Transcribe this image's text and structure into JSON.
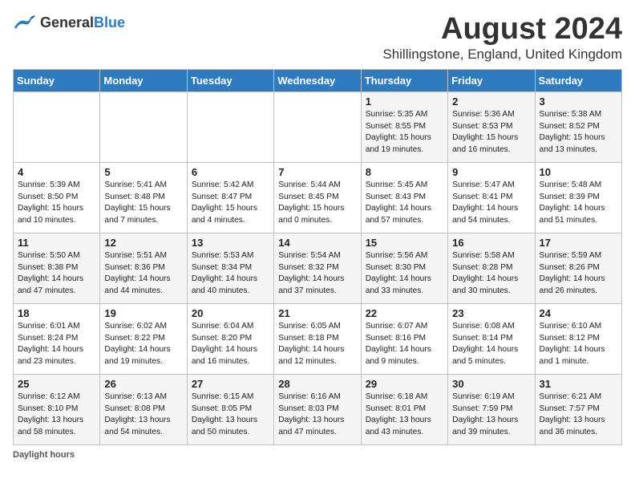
{
  "logo": {
    "general": "General",
    "blue": "Blue"
  },
  "title": "August 2024",
  "subtitle": "Shillingstone, England, United Kingdom",
  "days_of_week": [
    "Sunday",
    "Monday",
    "Tuesday",
    "Wednesday",
    "Thursday",
    "Friday",
    "Saturday"
  ],
  "footer": {
    "label": "Daylight hours",
    "note": "Daylight hours"
  },
  "weeks": [
    [
      {
        "day": "",
        "info": ""
      },
      {
        "day": "",
        "info": ""
      },
      {
        "day": "",
        "info": ""
      },
      {
        "day": "",
        "info": ""
      },
      {
        "day": "1",
        "info": "Sunrise: 5:35 AM\nSunset: 8:55 PM\nDaylight: 15 hours\nand 19 minutes."
      },
      {
        "day": "2",
        "info": "Sunrise: 5:36 AM\nSunset: 8:53 PM\nDaylight: 15 hours\nand 16 minutes."
      },
      {
        "day": "3",
        "info": "Sunrise: 5:38 AM\nSunset: 8:52 PM\nDaylight: 15 hours\nand 13 minutes."
      }
    ],
    [
      {
        "day": "4",
        "info": "Sunrise: 5:39 AM\nSunset: 8:50 PM\nDaylight: 15 hours\nand 10 minutes."
      },
      {
        "day": "5",
        "info": "Sunrise: 5:41 AM\nSunset: 8:48 PM\nDaylight: 15 hours\nand 7 minutes."
      },
      {
        "day": "6",
        "info": "Sunrise: 5:42 AM\nSunset: 8:47 PM\nDaylight: 15 hours\nand 4 minutes."
      },
      {
        "day": "7",
        "info": "Sunrise: 5:44 AM\nSunset: 8:45 PM\nDaylight: 15 hours\nand 0 minutes."
      },
      {
        "day": "8",
        "info": "Sunrise: 5:45 AM\nSunset: 8:43 PM\nDaylight: 14 hours\nand 57 minutes."
      },
      {
        "day": "9",
        "info": "Sunrise: 5:47 AM\nSunset: 8:41 PM\nDaylight: 14 hours\nand 54 minutes."
      },
      {
        "day": "10",
        "info": "Sunrise: 5:48 AM\nSunset: 8:39 PM\nDaylight: 14 hours\nand 51 minutes."
      }
    ],
    [
      {
        "day": "11",
        "info": "Sunrise: 5:50 AM\nSunset: 8:38 PM\nDaylight: 14 hours\nand 47 minutes."
      },
      {
        "day": "12",
        "info": "Sunrise: 5:51 AM\nSunset: 8:36 PM\nDaylight: 14 hours\nand 44 minutes."
      },
      {
        "day": "13",
        "info": "Sunrise: 5:53 AM\nSunset: 8:34 PM\nDaylight: 14 hours\nand 40 minutes."
      },
      {
        "day": "14",
        "info": "Sunrise: 5:54 AM\nSunset: 8:32 PM\nDaylight: 14 hours\nand 37 minutes."
      },
      {
        "day": "15",
        "info": "Sunrise: 5:56 AM\nSunset: 8:30 PM\nDaylight: 14 hours\nand 33 minutes."
      },
      {
        "day": "16",
        "info": "Sunrise: 5:58 AM\nSunset: 8:28 PM\nDaylight: 14 hours\nand 30 minutes."
      },
      {
        "day": "17",
        "info": "Sunrise: 5:59 AM\nSunset: 8:26 PM\nDaylight: 14 hours\nand 26 minutes."
      }
    ],
    [
      {
        "day": "18",
        "info": "Sunrise: 6:01 AM\nSunset: 8:24 PM\nDaylight: 14 hours\nand 23 minutes."
      },
      {
        "day": "19",
        "info": "Sunrise: 6:02 AM\nSunset: 8:22 PM\nDaylight: 14 hours\nand 19 minutes."
      },
      {
        "day": "20",
        "info": "Sunrise: 6:04 AM\nSunset: 8:20 PM\nDaylight: 14 hours\nand 16 minutes."
      },
      {
        "day": "21",
        "info": "Sunrise: 6:05 AM\nSunset: 8:18 PM\nDaylight: 14 hours\nand 12 minutes."
      },
      {
        "day": "22",
        "info": "Sunrise: 6:07 AM\nSunset: 8:16 PM\nDaylight: 14 hours\nand 9 minutes."
      },
      {
        "day": "23",
        "info": "Sunrise: 6:08 AM\nSunset: 8:14 PM\nDaylight: 14 hours\nand 5 minutes."
      },
      {
        "day": "24",
        "info": "Sunrise: 6:10 AM\nSunset: 8:12 PM\nDaylight: 14 hours\nand 1 minute."
      }
    ],
    [
      {
        "day": "25",
        "info": "Sunrise: 6:12 AM\nSunset: 8:10 PM\nDaylight: 13 hours\nand 58 minutes."
      },
      {
        "day": "26",
        "info": "Sunrise: 6:13 AM\nSunset: 8:08 PM\nDaylight: 13 hours\nand 54 minutes."
      },
      {
        "day": "27",
        "info": "Sunrise: 6:15 AM\nSunset: 8:05 PM\nDaylight: 13 hours\nand 50 minutes."
      },
      {
        "day": "28",
        "info": "Sunrise: 6:16 AM\nSunset: 8:03 PM\nDaylight: 13 hours\nand 47 minutes."
      },
      {
        "day": "29",
        "info": "Sunrise: 6:18 AM\nSunset: 8:01 PM\nDaylight: 13 hours\nand 43 minutes."
      },
      {
        "day": "30",
        "info": "Sunrise: 6:19 AM\nSunset: 7:59 PM\nDaylight: 13 hours\nand 39 minutes."
      },
      {
        "day": "31",
        "info": "Sunrise: 6:21 AM\nSunset: 7:57 PM\nDaylight: 13 hours\nand 36 minutes."
      }
    ]
  ]
}
